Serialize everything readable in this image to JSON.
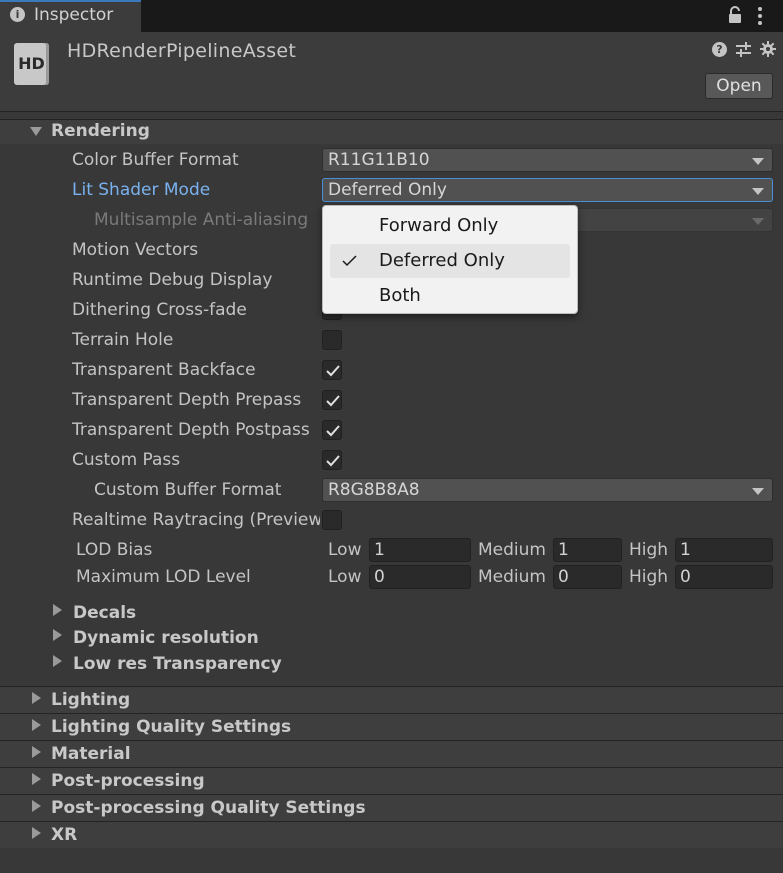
{
  "tab": {
    "label": "Inspector"
  },
  "header": {
    "asset_title": "HDRenderPipelineAsset",
    "icon_text": "HD",
    "open_label": "Open"
  },
  "rendering": {
    "title": "Rendering",
    "color_buffer_format": {
      "label": "Color Buffer Format",
      "value": "R11G11B10"
    },
    "lit_shader_mode": {
      "label": "Lit Shader Mode",
      "value": "Deferred Only"
    },
    "msaa": {
      "label": "Multisample Anti-aliasing"
    },
    "motion_vectors": {
      "label": "Motion Vectors"
    },
    "runtime_debug_display": {
      "label": "Runtime Debug Display"
    },
    "dithering_cross_fade": {
      "label": "Dithering Cross-fade"
    },
    "terrain_hole": {
      "label": "Terrain Hole",
      "checked": false
    },
    "transparent_backface": {
      "label": "Transparent Backface",
      "checked": true
    },
    "transparent_depth_prepass": {
      "label": "Transparent Depth Prepass",
      "checked": true
    },
    "transparent_depth_postpass": {
      "label": "Transparent Depth Postpass",
      "checked": true
    },
    "custom_pass": {
      "label": "Custom Pass",
      "checked": true
    },
    "custom_buffer_format": {
      "label": "Custom Buffer Format",
      "value": "R8G8B8A8"
    },
    "realtime_raytracing": {
      "label": "Realtime Raytracing (Preview)",
      "checked": false
    },
    "lod_bias": {
      "label": "LOD Bias",
      "low_label": "Low",
      "low": "1",
      "medium_label": "Medium",
      "medium": "1",
      "high_label": "High",
      "high": "1"
    },
    "max_lod_level": {
      "label": "Maximum LOD Level",
      "low_label": "Low",
      "low": "0",
      "medium_label": "Medium",
      "medium": "0",
      "high_label": "High",
      "high": "0"
    },
    "subsections": [
      "Decals",
      "Dynamic resolution",
      "Low res Transparency"
    ]
  },
  "sections": [
    "Lighting",
    "Lighting Quality Settings",
    "Material",
    "Post-processing",
    "Post-processing Quality Settings",
    "XR"
  ],
  "popup": {
    "options": [
      "Forward Only",
      "Deferred Only",
      "Both"
    ],
    "selected": "Deferred Only"
  },
  "colors": {
    "accent_blue": "#4a8fd6",
    "active_label": "#7ab2f0",
    "panel_bg": "#383838"
  }
}
